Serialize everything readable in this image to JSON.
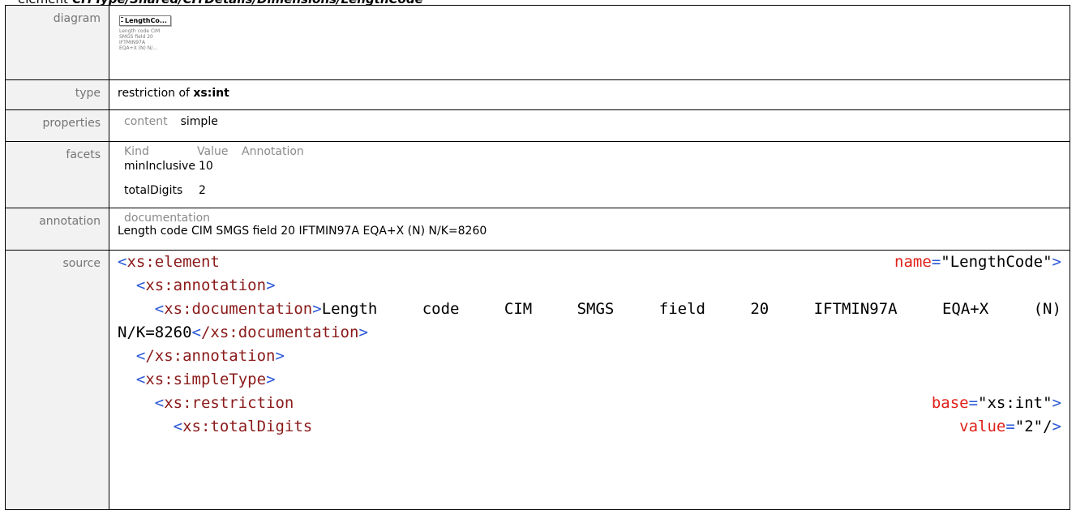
{
  "heading": {
    "prefix": "element",
    "path": "CITType/Shared/CITDetails/Dimensions/LengthCode"
  },
  "rows": {
    "diagram": {
      "label": "diagram",
      "box_label": "LengthCo...",
      "doc_lines": [
        "Length code CIM",
        "SMGS field 20",
        "IFTMIN97A",
        "EQA+X (N) N/..."
      ]
    },
    "type": {
      "label": "type",
      "prefix": "restriction of",
      "base": "xs:int"
    },
    "properties": {
      "label": "properties",
      "key": "content",
      "value": "simple"
    },
    "facets": {
      "label": "facets",
      "headers": [
        "Kind",
        "Value",
        "Annotation"
      ],
      "items": [
        {
          "kind": "minInclusive",
          "value": "10"
        },
        {
          "kind": "totalDigits",
          "value": "2"
        }
      ]
    },
    "annotation": {
      "label": "annotation",
      "key": "documentation",
      "text": "Length code CIM SMGS field 20 IFTMIN97A EQA+X (N) N/K=8260"
    },
    "source": {
      "label": "source",
      "l1_tag": "xs:element",
      "l1_attr": "name",
      "l1_val": "\"LengthCode\"",
      "l2_tag": "xs:annotation",
      "l3_tag": "xs:documentation",
      "l3_words": [
        "Length",
        "code",
        "CIM",
        "SMGS",
        "field",
        "20",
        "IFTMIN97A",
        "EQA+X",
        "(N)"
      ],
      "l4_text": "N/K=8260",
      "l4_tag": "/xs:documentation",
      "l5_tag": "/xs:annotation",
      "l6_tag": "xs:simpleType",
      "l7_tag": "xs:restriction",
      "l7_attr": "base",
      "l7_val": "\"xs:int\"",
      "l8_tag": "xs:totalDigits",
      "l8_attr": "value",
      "l8_val": "\"2\"/"
    }
  }
}
